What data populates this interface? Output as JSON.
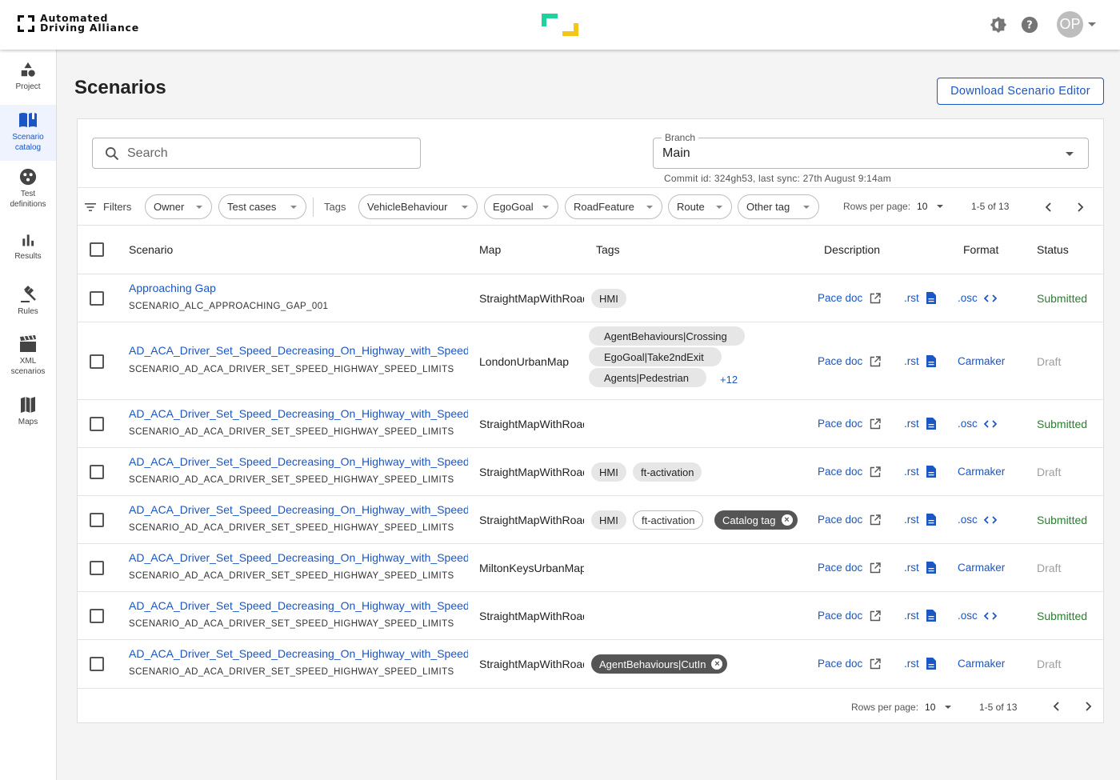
{
  "brand": {
    "line1": "Automated",
    "line2": "Driving Alliance"
  },
  "header": {
    "avatar_initials": "OP",
    "icons": [
      "theme-icon",
      "help-icon"
    ]
  },
  "sidebar": {
    "items": [
      {
        "label": "Project",
        "icon": "shapes-icon"
      },
      {
        "label": "Scenario catalog",
        "icon": "book-icon",
        "active": true
      },
      {
        "label": "Test definitions",
        "icon": "dots-circle-icon"
      },
      {
        "label": "Results",
        "icon": "bar-chart-icon"
      },
      {
        "label": "Rules",
        "icon": "gavel-icon"
      },
      {
        "label": "XML scenarios",
        "icon": "clapperboard-icon"
      },
      {
        "label": "Maps",
        "icon": "map-icon"
      }
    ]
  },
  "page": {
    "title": "Scenarios",
    "download_label": "Download Scenario Editor"
  },
  "search": {
    "placeholder": "Search"
  },
  "branch": {
    "label": "Branch",
    "value": "Main",
    "commit": "Commit id: 324gh53, last sync: 27th August 9:14am"
  },
  "filters": {
    "label": "Filters",
    "owner": "Owner",
    "test_cases": "Test cases",
    "tags_label": "Tags",
    "tag_selects": [
      "VehicleBehaviour",
      "EgoGoal",
      "RoadFeature",
      "Route",
      "Other tag"
    ],
    "rows_per_page_label": "Rows per page:",
    "rows_per_page_value": "10",
    "range": "1-5 of 13"
  },
  "columns": {
    "scenario": "Scenario",
    "map": "Map",
    "tags": "Tags",
    "description": "Description",
    "format": "Format",
    "status": "Status"
  },
  "links": {
    "pace_doc": "Pace doc",
    "rst": ".rst"
  },
  "rows": [
    {
      "name": "Approaching Gap",
      "id": "SCENARIO_ALC_APPROACHING_GAP_001",
      "map": "StraightMapWithRoad",
      "format": ".osc",
      "status": "Submitted"
    },
    {
      "name": "AD_ACA_Driver_Set_Speed_Decreasing_On_Highway_with_Speed_Limits",
      "id": "SCENARIO_AD_ACA_DRIVER_SET_SPEED_HIGHWAY_SPEED_LIMITS",
      "map": "LondonUrbanMap",
      "format": "Carmaker",
      "status": "Draft",
      "more_tags": "+12"
    },
    {
      "name": "AD_ACA_Driver_Set_Speed_Decreasing_On_Highway_with_Speed_Limits",
      "id": "SCENARIO_AD_ACA_DRIVER_SET_SPEED_HIGHWAY_SPEED_LIMITS",
      "map": "StraightMapWithRoad",
      "format": ".osc",
      "status": "Submitted"
    },
    {
      "name": "AD_ACA_Driver_Set_Speed_Decreasing_On_Highway_with_Speed_Limits",
      "id": "SCENARIO_AD_ACA_DRIVER_SET_SPEED_HIGHWAY_SPEED_LIMITS",
      "map": "StraightMapWithRoad",
      "format": "Carmaker",
      "status": "Draft"
    },
    {
      "name": "AD_ACA_Driver_Set_Speed_Decreasing_On_Highway_with_Speed_Limits",
      "id": "SCENARIO_AD_ACA_DRIVER_SET_SPEED_HIGHWAY_SPEED_LIMITS",
      "map": "StraightMapWithRoad",
      "format": ".osc",
      "status": "Submitted"
    },
    {
      "name": "AD_ACA_Driver_Set_Speed_Decreasing_On_Highway_with_Speed_Limits",
      "id": "SCENARIO_AD_ACA_DRIVER_SET_SPEED_HIGHWAY_SPEED_LIMITS",
      "map": "MiltonKeysUrbanMap",
      "format": "Carmaker",
      "status": "Draft"
    },
    {
      "name": "AD_ACA_Driver_Set_Speed_Decreasing_On_Highway_with_Speed_Limits",
      "id": "SCENARIO_AD_ACA_DRIVER_SET_SPEED_HIGHWAY_SPEED_LIMITS",
      "map": "StraightMapWithRoad",
      "format": ".osc",
      "status": "Submitted"
    },
    {
      "name": "AD_ACA_Driver_Set_Speed_Decreasing_On_Highway_with_Speed_Limits",
      "id": "SCENARIO_AD_ACA_DRIVER_SET_SPEED_HIGHWAY_SPEED_LIMITS",
      "map": "StraightMapWithRoad",
      "format": "Carmaker",
      "status": "Draft"
    }
  ],
  "tag_texts": {
    "hmi": "HMI",
    "ft_activation": "ft-activation",
    "catalog_tag": "Catalog tag",
    "agent_crossing": "AgentBehaviours|Crossing",
    "ego_2nd_exit": "EgoGoal|Take2ndExit",
    "agents_ped": "Agents|Pedestrian",
    "agent_cutin": "AgentBehaviours|CutIn"
  },
  "footer": {
    "rows_per_page_label": "Rows per page:",
    "rows_per_page_value": "10",
    "range": "1-5 of 13"
  },
  "colors": {
    "accent": "#1a56c4",
    "submitted": "#2e7d32",
    "draft": "#9e9e9e",
    "logo_green": "#1ed39b",
    "logo_yellow": "#f5c518"
  }
}
